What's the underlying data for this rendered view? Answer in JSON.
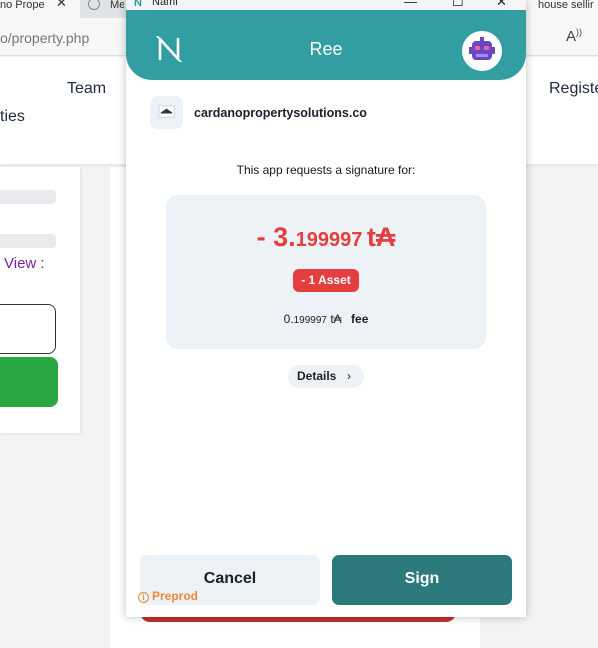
{
  "browser": {
    "tabs": [
      {
        "label": "no Prope"
      },
      {
        "label": "Me"
      },
      {
        "label": "house sellir"
      }
    ],
    "url": {
      "prefix": "o",
      "path": "/property.php"
    },
    "site_nav": {
      "team": "Team",
      "ties": "ties",
      "register": "Registe"
    },
    "site_text": {
      "view": "View :"
    }
  },
  "popup_window": {
    "title": "Nami",
    "controls": {
      "minimize": "—",
      "maximize": "☐",
      "close": "✕"
    }
  },
  "header": {
    "account_name": "Ree"
  },
  "origin": {
    "url": "cardanopropertysolutions.co"
  },
  "request": {
    "text": "This app requests a signature for:"
  },
  "summary": {
    "amount_main": "- 3.",
    "amount_decimals": "199997",
    "amount_unit": "t₳",
    "asset_badge": "- 1 Asset",
    "fee_int": "0.",
    "fee_decimals": "199997",
    "fee_unit": "t₳",
    "fee_label": "fee"
  },
  "details": {
    "label": "Details",
    "chevron": "›"
  },
  "actions": {
    "cancel": "Cancel",
    "sign": "Sign"
  },
  "network": {
    "label": "Preprod",
    "icon_glyph": "i"
  },
  "colors": {
    "header": "#329ea1",
    "sign_button": "#2c7a7b",
    "negative": "#e53e3e",
    "network": "#ed8936"
  }
}
